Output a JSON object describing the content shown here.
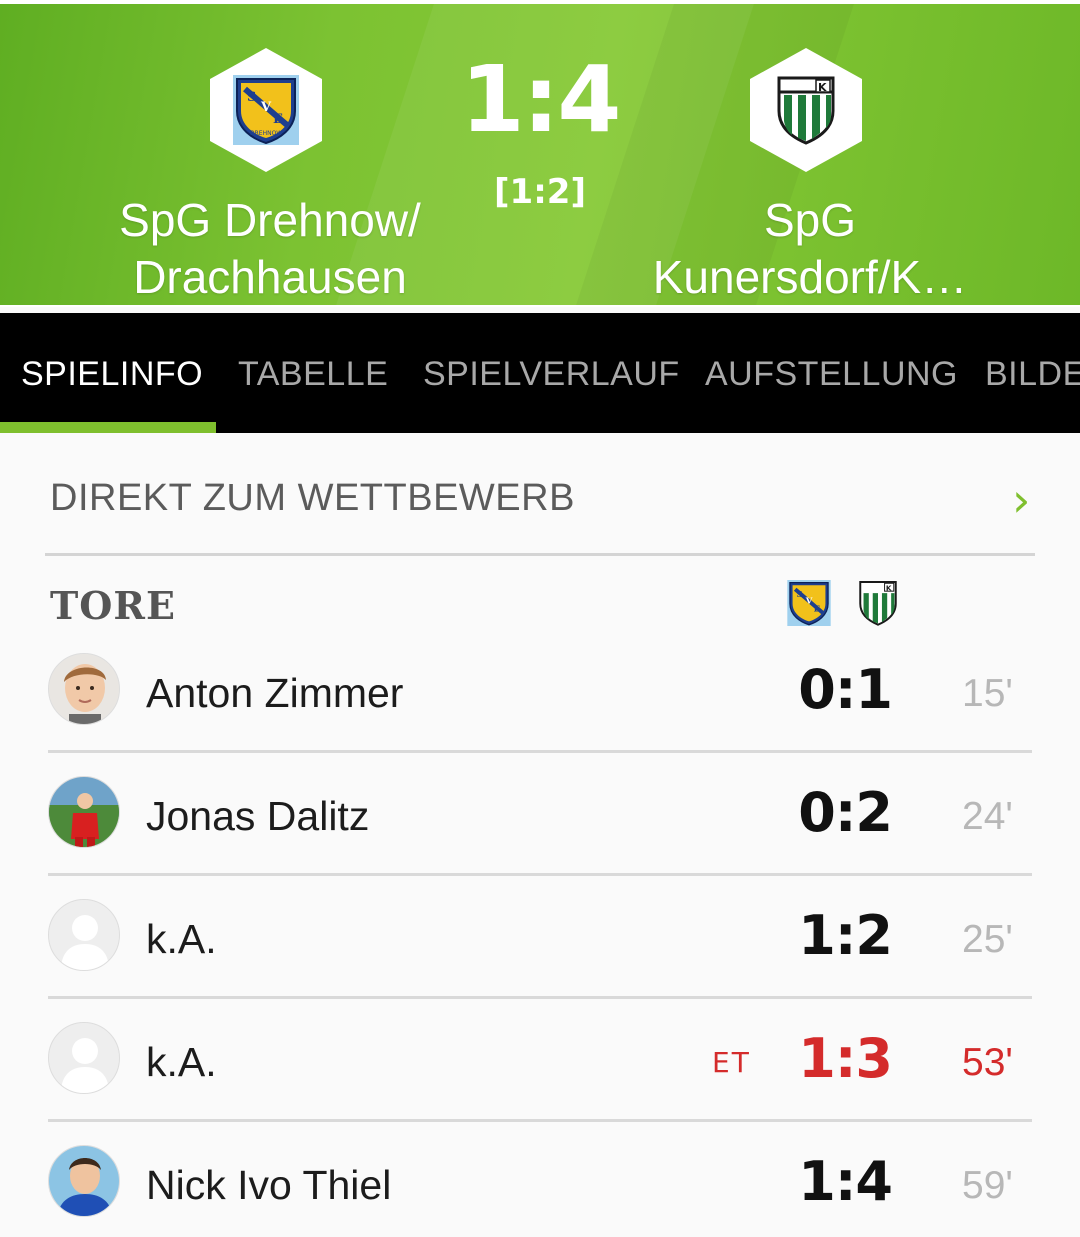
{
  "match": {
    "home_team": "SpG Drehnow/ Drachhausen",
    "away_team": "SpG Kunersdorf/K…",
    "score": "1:4",
    "halftime": "[1:2]",
    "home_crest_text": [
      "S",
      "V",
      "E",
      "DREHNOW"
    ],
    "away_crest_text": "K"
  },
  "tabs": [
    {
      "label": "SPIELINFO",
      "active": true
    },
    {
      "label": "TABELLE",
      "active": false
    },
    {
      "label": "SPIELVERLAUF",
      "active": false
    },
    {
      "label": "AUFSTELLUNG",
      "active": false
    },
    {
      "label": "BILDE",
      "active": false
    }
  ],
  "competition_link": {
    "label": "DIREKT ZUM WETTBEWERB"
  },
  "goals_section": {
    "title": "TORE"
  },
  "goals": [
    {
      "player": "Anton Zimmer",
      "score": "0:1",
      "minute": "15'",
      "own_goal": false,
      "avatar": "photo-boy-face"
    },
    {
      "player": "Jonas Dalitz",
      "score": "0:2",
      "minute": "24'",
      "own_goal": false,
      "avatar": "photo-red-jersey"
    },
    {
      "player": "k.A.",
      "score": "1:2",
      "minute": "25'",
      "own_goal": false,
      "avatar": "placeholder"
    },
    {
      "player": "k.A.",
      "score": "1:3",
      "minute": "53'",
      "own_goal": true,
      "own_goal_label": "ET",
      "avatar": "placeholder"
    },
    {
      "player": "Nick Ivo Thiel",
      "score": "1:4",
      "minute": "59'",
      "own_goal": false,
      "avatar": "photo-blue-jersey"
    }
  ],
  "colors": {
    "header_green": "#7cc232",
    "accent_green": "#7fbf2e",
    "own_goal_red": "#d42b2b",
    "tab_bar": "#000000"
  }
}
